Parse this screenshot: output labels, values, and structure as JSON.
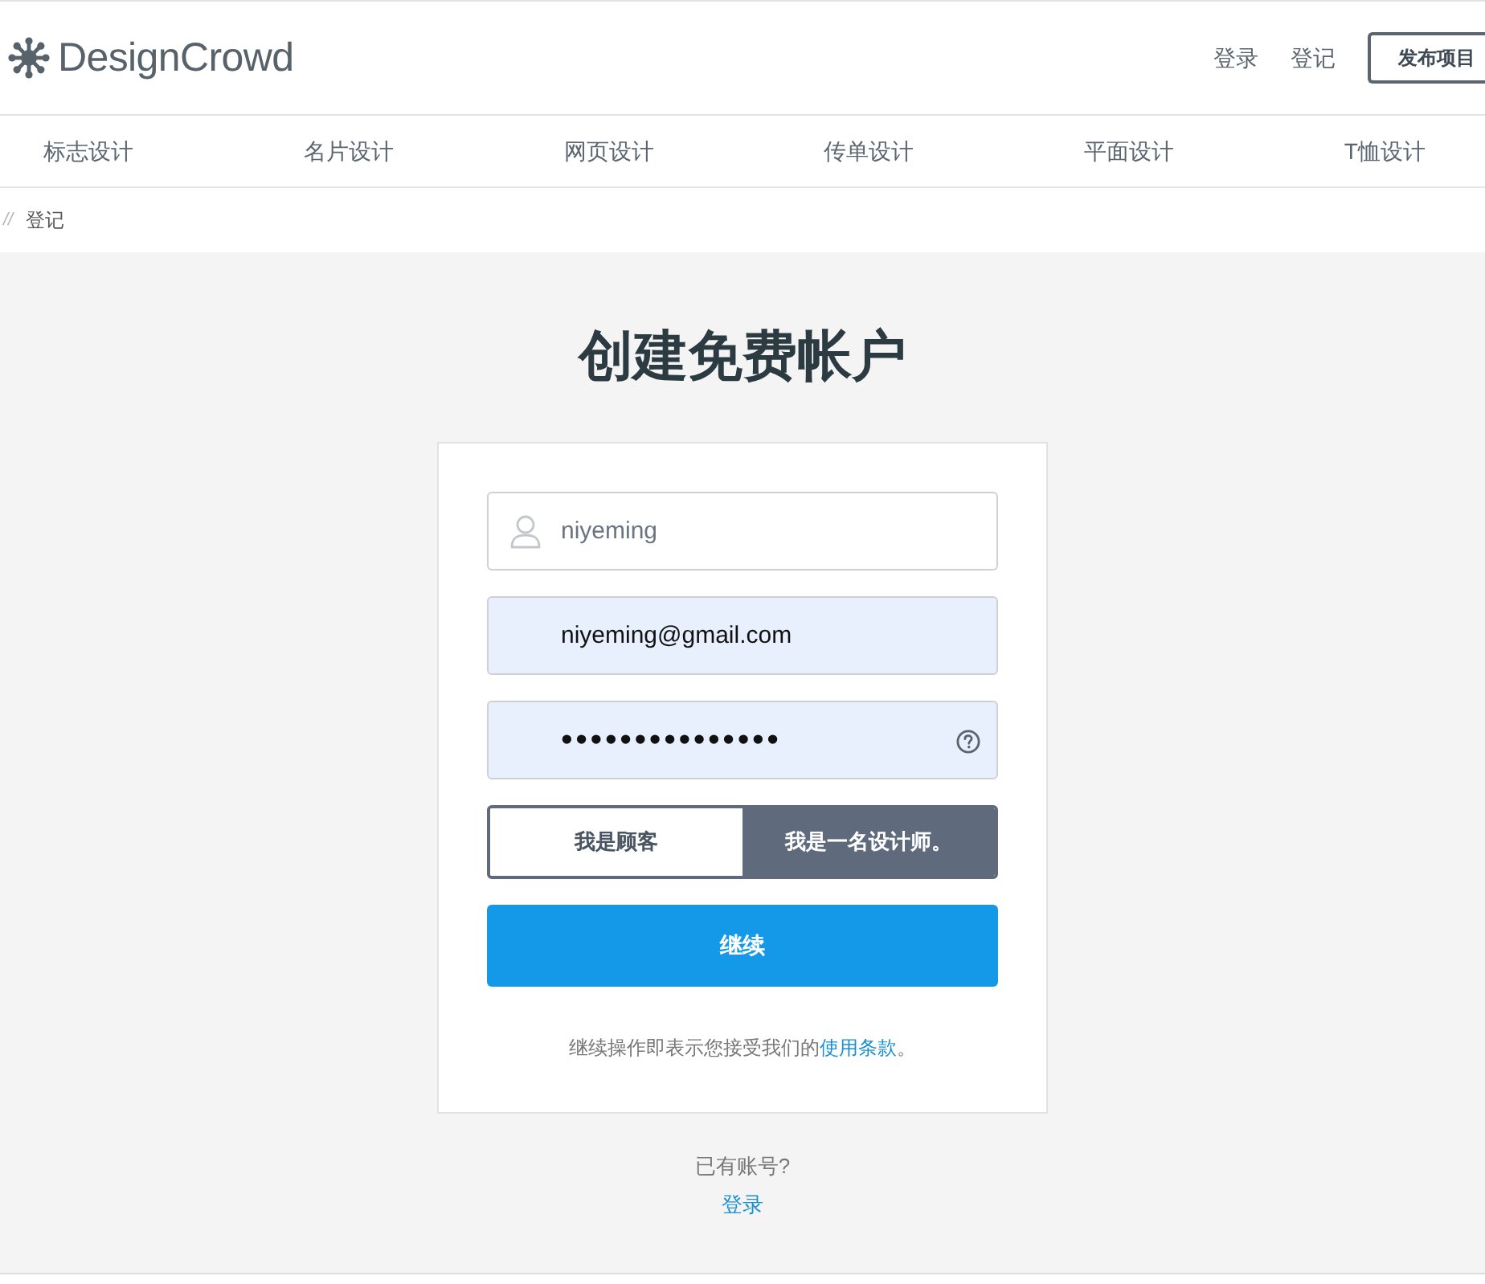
{
  "header": {
    "logo": "DesignCrowd",
    "links": [
      "登录",
      "登记"
    ],
    "post_button": "发布项目"
  },
  "nav": {
    "items": [
      "标志设计",
      "名片设计",
      "网页设计",
      "传单设计",
      "平面设计",
      "T恤设计"
    ]
  },
  "breadcrumb": {
    "separator": "//",
    "current": "登记"
  },
  "title": "创建免费帐户",
  "form": {
    "fields": [
      {
        "kind": "text",
        "value": "niyeming",
        "autofilled": false
      },
      {
        "kind": "email",
        "value": "niyeming@gmail.com",
        "autofilled": true
      },
      {
        "kind": "password",
        "value": "•••••••••••••••",
        "autofilled": true
      }
    ],
    "roles": [
      {
        "label": "我是顾客",
        "selected": false
      },
      {
        "label": "我是一名设计师。",
        "selected": true
      }
    ],
    "submit": "继续",
    "terms": {
      "text": "继续操作即表示您接受我们的",
      "link": "使用条款",
      "end": "。"
    }
  },
  "login_prompt": {
    "text": "已有账号?",
    "link": "登录"
  }
}
